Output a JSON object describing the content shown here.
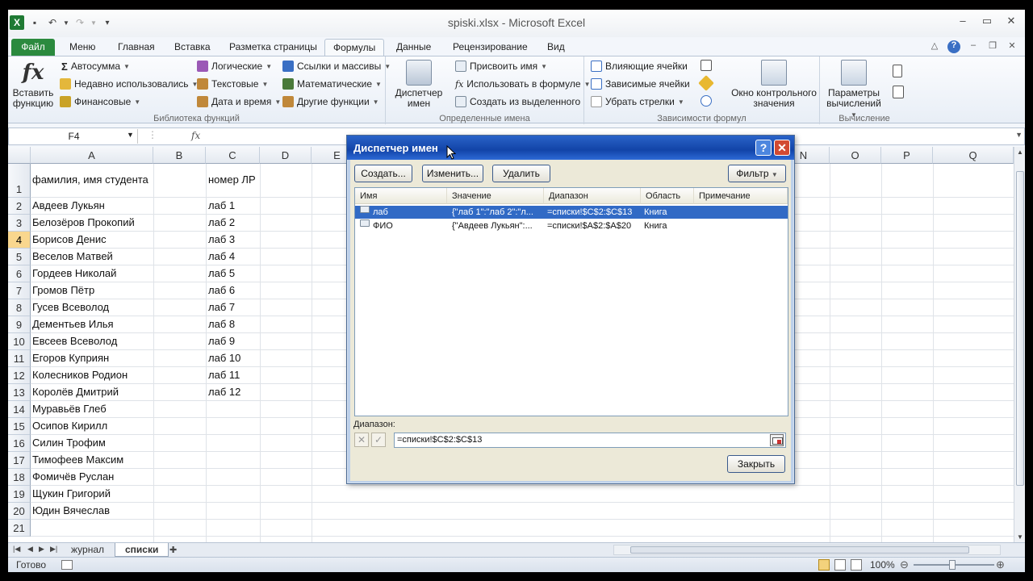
{
  "window": {
    "title": "spiski.xlsx  -  Microsoft Excel"
  },
  "ribbon_tabs": [
    {
      "label": "Файл"
    },
    {
      "label": "Меню"
    },
    {
      "label": "Главная"
    },
    {
      "label": "Вставка"
    },
    {
      "label": "Разметка страницы"
    },
    {
      "label": "Формулы"
    },
    {
      "label": "Данные"
    },
    {
      "label": "Рецензирование"
    },
    {
      "label": "Вид"
    }
  ],
  "active_tab": "Формулы",
  "ribbon": {
    "insert_function": {
      "line1": "Вставить",
      "line2": "функцию"
    },
    "function_library": {
      "items": [
        {
          "label": "Автосумма"
        },
        {
          "label": "Недавно использовались"
        },
        {
          "label": "Финансовые"
        },
        {
          "label": "Логические"
        },
        {
          "label": "Текстовые"
        },
        {
          "label": "Дата и время"
        },
        {
          "label": "Ссылки и массивы"
        },
        {
          "label": "Математические"
        },
        {
          "label": "Другие функции"
        }
      ],
      "label": "Библиотека функций"
    },
    "defined_names": {
      "manager": {
        "line1": "Диспетчер",
        "line2": "имен"
      },
      "items": [
        {
          "label": "Присвоить имя"
        },
        {
          "label": "Использовать в формуле"
        },
        {
          "label": "Создать из выделенного"
        }
      ],
      "label": "Определенные имена"
    },
    "formula_auditing": {
      "items": [
        {
          "label": "Влияющие ячейки"
        },
        {
          "label": "Зависимые ячейки"
        },
        {
          "label": "Убрать стрелки"
        }
      ],
      "watch": {
        "line1": "Окно контрольного",
        "line2": "значения"
      },
      "label": "Зависимости формул"
    },
    "calculation": {
      "options": {
        "line1": "Параметры",
        "line2": "вычислений"
      },
      "label": "Вычисление"
    }
  },
  "formula_bar": {
    "name_box": "F4",
    "fx": "fx",
    "formula": ""
  },
  "columns": [
    "A",
    "B",
    "C",
    "D",
    "E",
    "N",
    "O",
    "P",
    "Q"
  ],
  "rows": [
    {
      "n": "1",
      "a": "фамилия, имя студента",
      "c": "номер ЛР"
    },
    {
      "n": "2",
      "a": "Авдеев Лукьян",
      "c": "лаб 1"
    },
    {
      "n": "3",
      "a": "Белозёров Прокопий",
      "c": "лаб 2"
    },
    {
      "n": "4",
      "a": "Борисов Денис",
      "c": "лаб 3"
    },
    {
      "n": "5",
      "a": "Веселов Матвей",
      "c": "лаб 4"
    },
    {
      "n": "6",
      "a": "Гордеев Николай",
      "c": "лаб 5"
    },
    {
      "n": "7",
      "a": "Громов Пётр",
      "c": "лаб 6"
    },
    {
      "n": "8",
      "a": "Гусев Всеволод",
      "c": "лаб 7"
    },
    {
      "n": "9",
      "a": "Дементьев Илья",
      "c": "лаб 8"
    },
    {
      "n": "10",
      "a": "Евсеев Всеволод",
      "c": "лаб 9"
    },
    {
      "n": "11",
      "a": "Егоров Куприян",
      "c": "лаб 10"
    },
    {
      "n": "12",
      "a": "Колесников Родион",
      "c": "лаб 11"
    },
    {
      "n": "13",
      "a": "Королёв Дмитрий",
      "c": "лаб 12"
    },
    {
      "n": "14",
      "a": "Муравьёв Глеб",
      "c": ""
    },
    {
      "n": "15",
      "a": "Осипов Кирилл",
      "c": ""
    },
    {
      "n": "16",
      "a": "Силин Трофим",
      "c": ""
    },
    {
      "n": "17",
      "a": "Тимофеев Максим",
      "c": ""
    },
    {
      "n": "18",
      "a": "Фомичёв Руслан",
      "c": ""
    },
    {
      "n": "19",
      "a": "Щукин Григорий",
      "c": ""
    },
    {
      "n": "20",
      "a": "Юдин Вячеслав",
      "c": ""
    },
    {
      "n": "21",
      "a": "",
      "c": ""
    }
  ],
  "selected_row": "4",
  "sheet_tabs": [
    {
      "label": "журнал"
    },
    {
      "label": "списки"
    }
  ],
  "active_sheet": "списки",
  "status": {
    "ready": "Готово",
    "zoom": "100%"
  },
  "dialog": {
    "title": "Диспетчер имен",
    "buttons": {
      "create": "Создать...",
      "edit": "Изменить...",
      "delete": "Удалить",
      "filter": "Фильтр",
      "close": "Закрыть"
    },
    "list_headers": [
      "Имя",
      "Значение",
      "Диапазон",
      "Область",
      "Примечание"
    ],
    "names": [
      {
        "name": "лаб",
        "value": "{\"лаб 1\":\"лаб 2\":\"л...",
        "range": "=списки!$C$2:$C$13",
        "scope": "Книга",
        "note": "",
        "selected": true
      },
      {
        "name": "ФИО",
        "value": "{\"Авдеев Лукьян\":...",
        "range": "=списки!$A$2:$A$20",
        "scope": "Книга",
        "note": "",
        "selected": false
      }
    ],
    "range_label": "Диапазон:",
    "range_value": "=списки!$C$2:$C$13"
  },
  "colors": {
    "file_tab": "#2b8a3e",
    "dialog_title": "#1244a8",
    "selection": "#316ac5"
  }
}
